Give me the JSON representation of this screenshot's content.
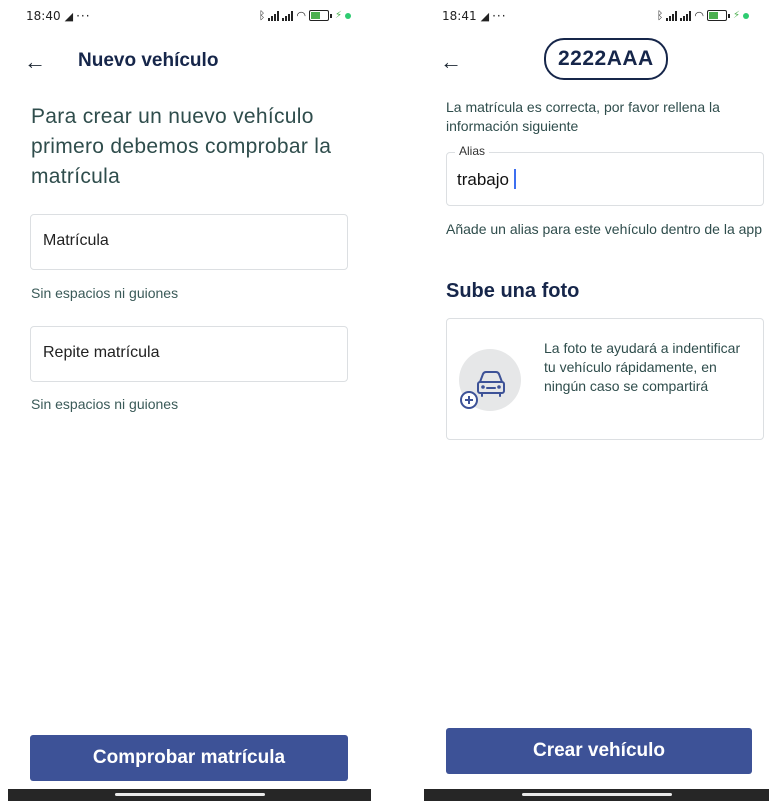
{
  "left_screen": {
    "status": {
      "time": "18:40",
      "more": "···"
    },
    "appbar": {
      "back_icon": "arrow-left-icon",
      "title": "Nuevo vehículo"
    },
    "headline": "Para crear un nuevo vehículo primero debemos comprobar la matrícula",
    "plate_field": {
      "label": "Matrícula",
      "helper": "Sin espacios ni guiones"
    },
    "repeat_field": {
      "label": "Repite matrícula",
      "helper": "Sin espacios ni guiones"
    },
    "submit_label": "Comprobar matrícula"
  },
  "right_screen": {
    "status": {
      "time": "18:41",
      "more": "···"
    },
    "appbar": {
      "back_icon": "arrow-left-icon",
      "plate": "2222AAA"
    },
    "info": "La matrícula es correcta, por favor rellena la información siguiente",
    "alias_field": {
      "label": "Alias",
      "value": "trabajo"
    },
    "alias_helper": "Añade un alias para este vehículo dentro de la app",
    "photo_section": {
      "title": "Sube una foto",
      "icon": "add-car-photo-icon",
      "description": "La foto te ayudará a indentificar tu vehículo rápidamente, en ningún caso se compartirá"
    },
    "submit_label": "Crear vehículo"
  },
  "status_icons": {
    "battery_level": "41"
  },
  "colors": {
    "primary": "#3d5297",
    "title_navy": "#16264a",
    "text_teal": "#2f4d4c"
  }
}
